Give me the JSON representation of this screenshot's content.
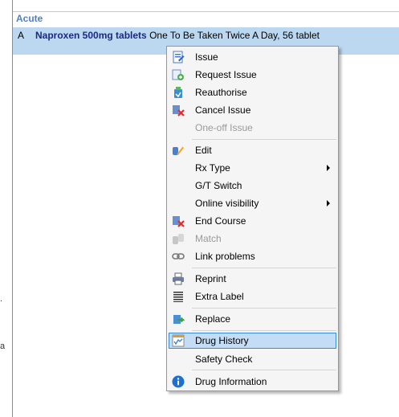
{
  "left_marks": [
    ".",
    "a"
  ],
  "group": {
    "title": "Acute"
  },
  "drug": {
    "code": "A",
    "name": "Naproxen 500mg tablets",
    "details": "One To Be Taken Twice A Day, 56 tablet"
  },
  "menu": {
    "items": [
      {
        "label": "Issue",
        "icon": "issue-icon",
        "disabled": false
      },
      {
        "label": "Request Issue",
        "icon": "request-issue-icon",
        "disabled": false
      },
      {
        "label": "Reauthorise",
        "icon": "reauthorise-icon",
        "disabled": false
      },
      {
        "label": "Cancel Issue",
        "icon": "cancel-issue-icon",
        "disabled": false
      },
      {
        "label": "One-off Issue",
        "icon": "",
        "disabled": true
      },
      {
        "label": "Edit",
        "icon": "edit-icon",
        "disabled": false
      },
      {
        "label": "Rx Type",
        "icon": "",
        "disabled": false,
        "submenu": true
      },
      {
        "label": "G/T Switch",
        "icon": "",
        "disabled": false
      },
      {
        "label": "Online visibility",
        "icon": "",
        "disabled": false,
        "submenu": true
      },
      {
        "label": "End Course",
        "icon": "end-course-icon",
        "disabled": false
      },
      {
        "label": "Match",
        "icon": "match-icon",
        "disabled": true
      },
      {
        "label": "Link problems",
        "icon": "link-icon",
        "disabled": false
      },
      {
        "label": "Reprint",
        "icon": "printer-icon",
        "disabled": false
      },
      {
        "label": "Extra Label",
        "icon": "label-lines-icon",
        "disabled": false
      },
      {
        "label": "Replace",
        "icon": "replace-icon",
        "disabled": false
      },
      {
        "label": "Drug History",
        "icon": "drug-history-icon",
        "disabled": false,
        "highlighted": true
      },
      {
        "label": "Safety Check",
        "icon": "",
        "disabled": false
      },
      {
        "label": "Drug Information",
        "icon": "info-icon",
        "disabled": false
      }
    ]
  }
}
